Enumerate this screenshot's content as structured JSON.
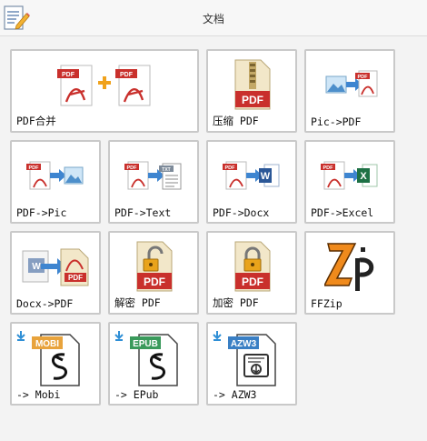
{
  "header": {
    "title": "文档",
    "icon": "document-edit-icon"
  },
  "tiles": [
    {
      "id": "pdf-merge",
      "label": "PDF合并",
      "icon": "pdf-merge-icon"
    },
    {
      "id": "compress-pdf",
      "label": "压缩 PDF",
      "icon": "pdf-compress-icon"
    },
    {
      "id": "pic-to-pdf",
      "label": "Pic->PDF",
      "icon": "pic-to-pdf-icon"
    },
    {
      "id": "pdf-to-pic",
      "label": "PDF->Pic",
      "icon": "pdf-to-pic-icon"
    },
    {
      "id": "pdf-to-text",
      "label": "PDF->Text",
      "icon": "pdf-to-text-icon"
    },
    {
      "id": "pdf-to-docx",
      "label": "PDF->Docx",
      "icon": "pdf-to-docx-icon"
    },
    {
      "id": "pdf-to-excel",
      "label": "PDF->Excel",
      "icon": "pdf-to-excel-icon"
    },
    {
      "id": "docx-to-pdf",
      "label": "Docx->PDF",
      "icon": "docx-to-pdf-icon"
    },
    {
      "id": "decrypt-pdf",
      "label": "解密 PDF",
      "icon": "pdf-unlock-icon"
    },
    {
      "id": "encrypt-pdf",
      "label": "加密 PDF",
      "icon": "pdf-lock-icon"
    },
    {
      "id": "ffzip",
      "label": "FFZip",
      "icon": "ffzip-logo-icon"
    },
    {
      "id": "to-mobi",
      "label": "-> Mobi",
      "icon": "mobi-file-icon",
      "badge": "MOBI"
    },
    {
      "id": "to-epub",
      "label": "-> EPub",
      "icon": "epub-file-icon",
      "badge": "EPUB"
    },
    {
      "id": "to-azw3",
      "label": "-> AZW3",
      "icon": "azw3-file-icon",
      "badge": "AZW3"
    }
  ],
  "colors": {
    "pdf_red": "#c9302c",
    "word_blue": "#2b5797",
    "excel_green": "#1e7145",
    "mobi_orange": "#e8a33c",
    "epub_green": "#3a9a5b",
    "azw3_blue": "#3a7fc4",
    "ffzip_orange": "#f08a1c"
  }
}
